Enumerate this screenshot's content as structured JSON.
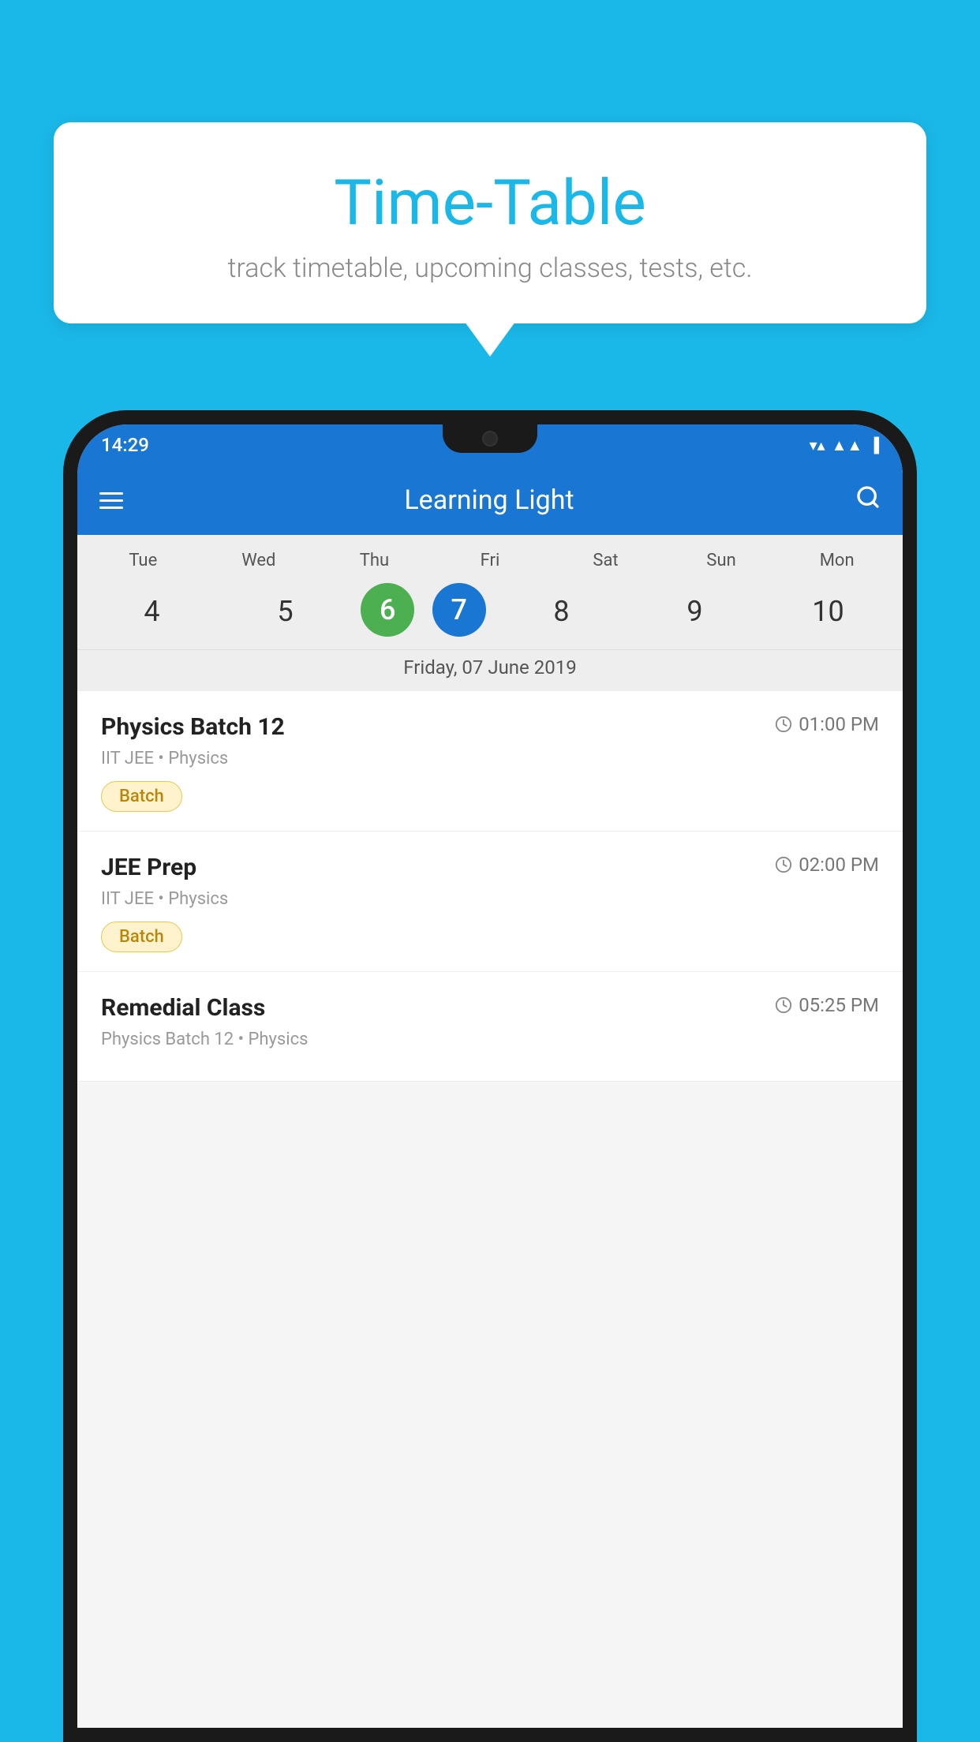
{
  "background_color": "#1ab8e8",
  "speech_bubble": {
    "title": "Time-Table",
    "subtitle": "track timetable, upcoming classes, tests, etc."
  },
  "status_bar": {
    "time": "14:29"
  },
  "app_header": {
    "title": "Learning Light",
    "menu_icon": "hamburger-icon",
    "search_icon": "search-icon"
  },
  "calendar": {
    "days": [
      "Tue",
      "Wed",
      "Thu",
      "Fri",
      "Sat",
      "Sun",
      "Mon"
    ],
    "dates": [
      "4",
      "5",
      "6",
      "7",
      "8",
      "9",
      "10"
    ],
    "today_index": 2,
    "selected_index": 3,
    "selected_label": "Friday, 07 June 2019"
  },
  "schedule_items": [
    {
      "title": "Physics Batch 12",
      "time": "01:00 PM",
      "subtitle": "IIT JEE • Physics",
      "badge": "Batch"
    },
    {
      "title": "JEE Prep",
      "time": "02:00 PM",
      "subtitle": "IIT JEE • Physics",
      "badge": "Batch"
    },
    {
      "title": "Remedial Class",
      "time": "05:25 PM",
      "subtitle": "Physics Batch 12 • Physics",
      "badge": null
    }
  ]
}
